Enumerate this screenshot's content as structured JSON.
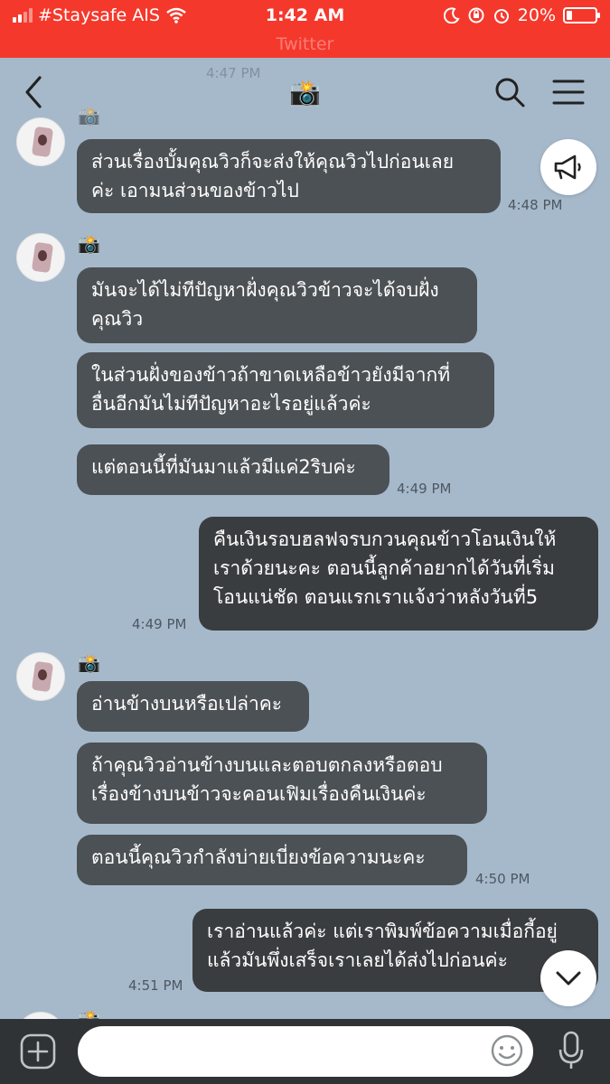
{
  "status_bar": {
    "carrier": "#Staysafe AIS",
    "time": "1:42 AM",
    "battery": "20%",
    "battery_level": 0.2,
    "ghost_title": "Twitter"
  },
  "header": {
    "title_emoji": "📸",
    "ghost_time": "4:47 PM"
  },
  "messages": [
    {
      "dir": "in",
      "text": "ส่วนเรื่องบั้มคุณวิวก็จะส่งให้คุณวิวไปก่อนเลย\nค่ะ เอามนส่วนของข้าวไป",
      "time": "4:48 PM"
    },
    {
      "dir": "in",
      "text": "มันจะได้ไม่ทีปัญหาฝั่งคุณวิวข้าวจะได้จบฝั่ง\nคุณวิว",
      "time": ""
    },
    {
      "dir": "in",
      "text": "ในส่วนฝั่งของข้าวถ้าขาดเหลือข้าวยังมีจากที่\nอื่นอีกมันไม่ทีปัญหาอะไรอยู่แล้วค่ะ",
      "time": ""
    },
    {
      "dir": "in",
      "text": "แต่ตอนนี้ที่มันมาแล้วมีแค่2ริบค่ะ",
      "time": "4:49 PM"
    },
    {
      "dir": "out",
      "text": "คืนเงินรอบฮลฟจรบกวนคุณข้าวโอนเงินให้\nเราด้วยนะคะ ตอนนี้ลูกค้าอยากได้วันที่เริ่ม\nโอนแน่ชัด ตอนแรกเราแจ้งว่าหลังวันที่5",
      "time": "4:49 PM"
    },
    {
      "dir": "in",
      "text": "อ่านข้างบนหรือเปล่าคะ",
      "time": ""
    },
    {
      "dir": "in",
      "text": "ถ้าคุณวิวอ่านข้างบนและตอบตกลงหรือตอบ\nเรื่องข้างบนข้าวจะคอนเฟิมเรื่องคืนเงินค่ะ",
      "time": ""
    },
    {
      "dir": "in",
      "text": "ตอนนี้คุณวิวกำลังบ่ายเบี่ยงข้อความนะคะ",
      "time": "4:50 PM"
    },
    {
      "dir": "out",
      "text": "เราอ่านแล้วค่ะ แต่เราพิมพ์ข้อความเมื่อกี้อยู่\nแล้วมันพึ่งเสร็จเราเลยได้ส่งไปก่อนค่ะ",
      "time": "4:51 PM"
    }
  ],
  "colors": {
    "status_bar": "#f5382c",
    "chat_background": "#a6b9cb",
    "incoming_bubble": "#4c5155",
    "outgoing_bubble": "#3a3d3f",
    "input_bar": "#2f3335"
  },
  "icons": [
    "back-icon",
    "search-icon",
    "menu-icon",
    "megaphone-icon",
    "chevron-down-icon",
    "plus-icon",
    "emoji-icon",
    "microphone-icon",
    "wifi-icon",
    "moon-icon",
    "alarm-icon",
    "orientation-lock-icon"
  ]
}
